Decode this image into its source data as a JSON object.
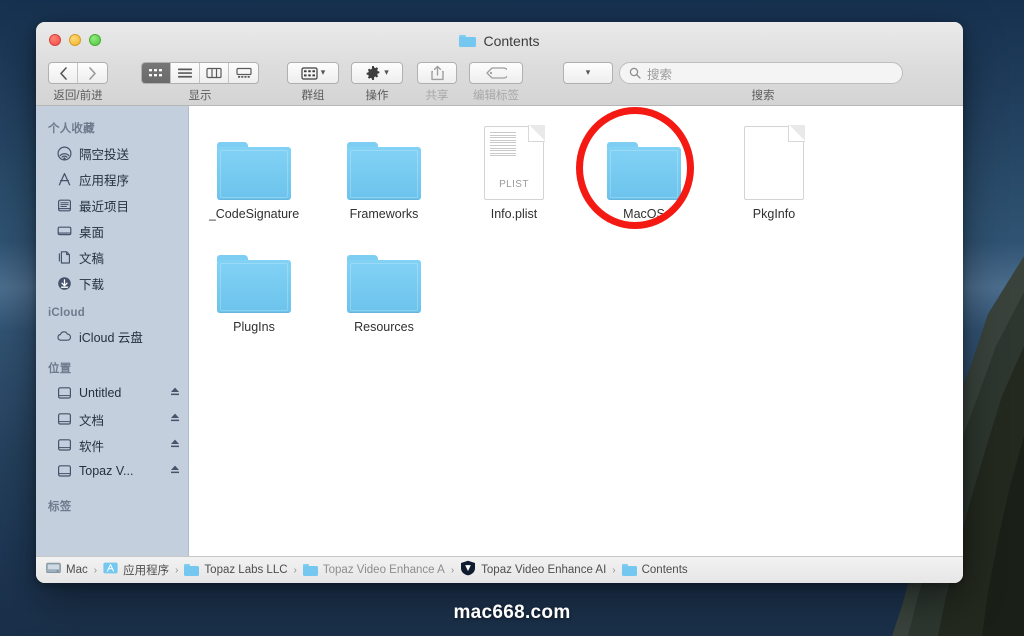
{
  "window": {
    "title": "Contents",
    "traffic_lights": [
      "close",
      "minimize",
      "zoom"
    ]
  },
  "toolbar": {
    "nav_caption": "返回/前进",
    "back_label": "‹",
    "forward_label": "›",
    "view_caption": "显示",
    "view_modes": [
      "icon-view",
      "list-view",
      "column-view",
      "gallery-view"
    ],
    "group_caption": "群组",
    "action_caption": "操作",
    "share_caption": "共享",
    "tags_caption": "编辑标签",
    "search_caption": "搜索",
    "search_placeholder": "搜索",
    "arrange_caption": ""
  },
  "sidebar": {
    "sections": [
      {
        "header": "个人收藏",
        "items": [
          {
            "label": "隔空投送",
            "icon": "airdrop-icon",
            "eject": false
          },
          {
            "label": "应用程序",
            "icon": "applications-icon",
            "eject": false
          },
          {
            "label": "最近项目",
            "icon": "recents-icon",
            "eject": false
          },
          {
            "label": "桌面",
            "icon": "desktop-icon",
            "eject": false
          },
          {
            "label": "文稿",
            "icon": "documents-icon",
            "eject": false
          },
          {
            "label": "下载",
            "icon": "downloads-icon",
            "eject": false
          }
        ]
      },
      {
        "header": "iCloud",
        "items": [
          {
            "label": "iCloud 云盘",
            "icon": "icloud-icon",
            "eject": false
          }
        ]
      },
      {
        "header": "位置",
        "items": [
          {
            "label": "Untitled",
            "icon": "disk-icon",
            "eject": true
          },
          {
            "label": "文档",
            "icon": "disk-icon",
            "eject": true
          },
          {
            "label": "软件",
            "icon": "disk-icon",
            "eject": true
          },
          {
            "label": "Topaz V...",
            "icon": "disk-icon",
            "eject": true
          }
        ]
      },
      {
        "header": "标签",
        "items": []
      }
    ]
  },
  "content": {
    "files": [
      {
        "name": "_CodeSignature",
        "type": "folder"
      },
      {
        "name": "Frameworks",
        "type": "folder"
      },
      {
        "name": "Info.plist",
        "type": "document",
        "kind": "PLIST"
      },
      {
        "name": "MacOS",
        "type": "folder",
        "annotated": true
      },
      {
        "name": "PkgInfo",
        "type": "document",
        "kind": ""
      },
      {
        "name": "PlugIns",
        "type": "folder"
      },
      {
        "name": "Resources",
        "type": "folder"
      }
    ],
    "annotation_color": "#f41a13"
  },
  "pathbar": {
    "crumbs": [
      {
        "label": "Mac",
        "icon": "hard-disk-icon"
      },
      {
        "label": "应用程序",
        "icon": "applications-folder-icon"
      },
      {
        "label": "Topaz Labs LLC",
        "icon": "folder-icon"
      },
      {
        "label": "Topaz Video Enhance A",
        "icon": "folder-icon"
      },
      {
        "label": "Topaz Video Enhance AI",
        "icon": "topaz-app-icon"
      },
      {
        "label": "Contents",
        "icon": "folder-icon"
      }
    ],
    "separator": "›"
  },
  "watermark": {
    "text": "mac668.com"
  },
  "colors": {
    "folder_blue": "#74c8f0",
    "sidebar_bg": "#c3cfdd",
    "accent_red": "#f41a13",
    "desktop_blue": "#2d506f"
  }
}
